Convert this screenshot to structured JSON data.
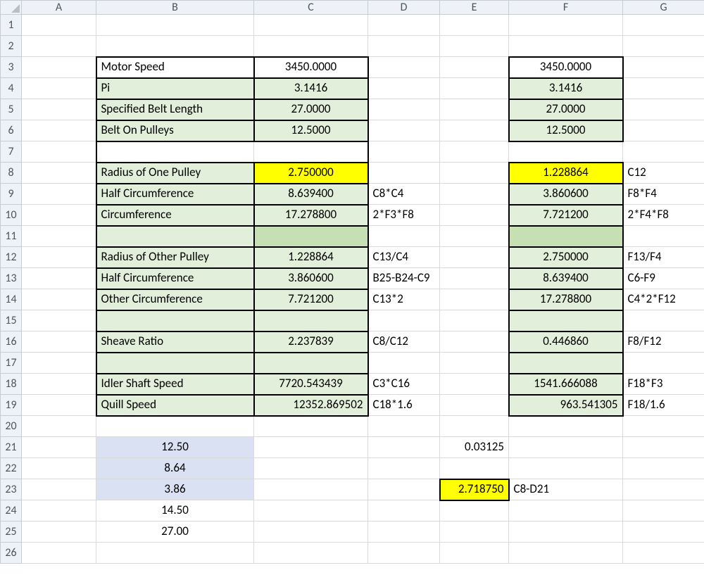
{
  "columns": [
    "A",
    "B",
    "C",
    "D",
    "E",
    "F",
    "G"
  ],
  "rows": [
    "1",
    "2",
    "3",
    "4",
    "5",
    "6",
    "7",
    "8",
    "9",
    "10",
    "11",
    "12",
    "13",
    "14",
    "15",
    "16",
    "17",
    "18",
    "19",
    "20",
    "21",
    "22",
    "23",
    "24",
    "25",
    "26"
  ],
  "labels": {
    "motor_speed": "Motor Speed",
    "pi": "Pi",
    "spec_belt_len": "Specified Belt Length",
    "belt_on_pulleys": "Belt On Pulleys",
    "radius_one": "Radius of One Pulley",
    "half_circ": "Half Circumference",
    "circ": "Circumference",
    "radius_other": "Radius of Other  Pulley",
    "half_circ2": "Half Circumference",
    "other_circ": "Other Circumference",
    "sheave_ratio": "Sheave Ratio",
    "idler_speed": "Idler Shaft Speed",
    "quill_speed": "Quill Speed"
  },
  "valC": {
    "r3": "3450.0000",
    "r4": "3.1416",
    "r5": "27.0000",
    "r6": "12.5000",
    "r8": "2.750000",
    "r9": "8.639400",
    "r10": "17.278800",
    "r12": "1.228864",
    "r13": "3.860600",
    "r14": "7.721200",
    "r16": "2.237839",
    "r18": "7720.543439",
    "r19": "12352.869502"
  },
  "valF": {
    "r3": "3450.0000",
    "r4": "3.1416",
    "r5": "27.0000",
    "r6": "12.5000",
    "r8": "1.228864",
    "r9": "3.860600",
    "r10": "7.721200",
    "r12": "2.750000",
    "r13": "8.639400",
    "r14": "17.278800",
    "r16": "0.446860",
    "r18": "1541.666088",
    "r19": "963.541305"
  },
  "formD": {
    "r9": "C8*C4",
    "r10": "2*F3*F8",
    "r12": "C13/C4",
    "r13": "B25-B24-C9",
    "r14": "C13*2",
    "r16": "C8/C12",
    "r18": "C3*C16",
    "r19": "C18*1.6"
  },
  "formG": {
    "r8": "C12",
    "r9": "F8*F4",
    "r10": "2*F4*F8",
    "r12": "F13/F4",
    "r13": "C6-F9",
    "r14": "C4*2*F12",
    "r16": "F8/F12",
    "r18": "F18*F3",
    "r19": "F18/1.6"
  },
  "bottom": {
    "b21": "12.50",
    "b22": "8.64",
    "b23": "3.86",
    "b24": "14.50",
    "b25": "27.00",
    "e21": "0.03125",
    "e23": "2.718750",
    "f23": "C8-D21"
  }
}
